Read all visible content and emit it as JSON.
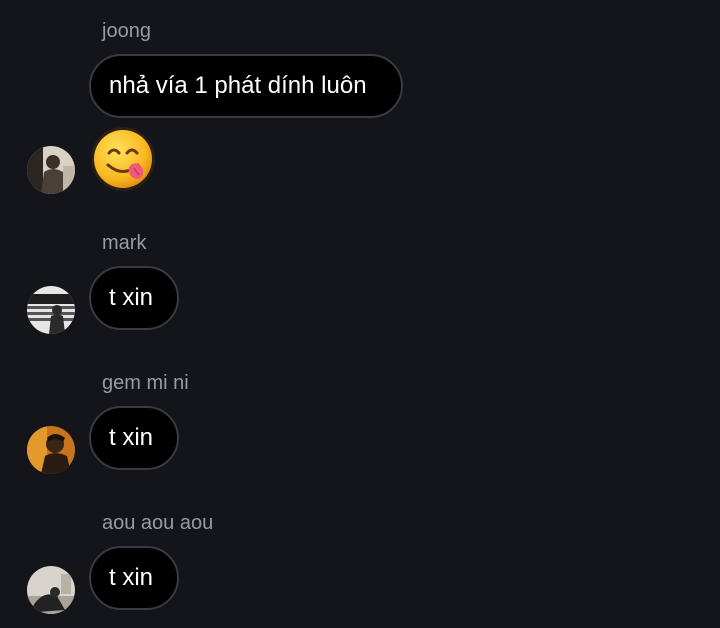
{
  "messages": [
    {
      "sender": "joong",
      "text": "nhả vía 1 phát dính luôn",
      "reaction_icon": "face-savoring-food-emoji"
    },
    {
      "sender": "mark",
      "text": "t xin"
    },
    {
      "sender": "gem mi ni",
      "text": "t xin"
    },
    {
      "sender": "aou aou aou",
      "text": "t xin"
    }
  ],
  "colors": {
    "background": "#14141b",
    "bubble": "#000000",
    "bubble_border": "#3a3a42",
    "sender_text": "#9a9aa3",
    "message_text": "#ffffff"
  }
}
